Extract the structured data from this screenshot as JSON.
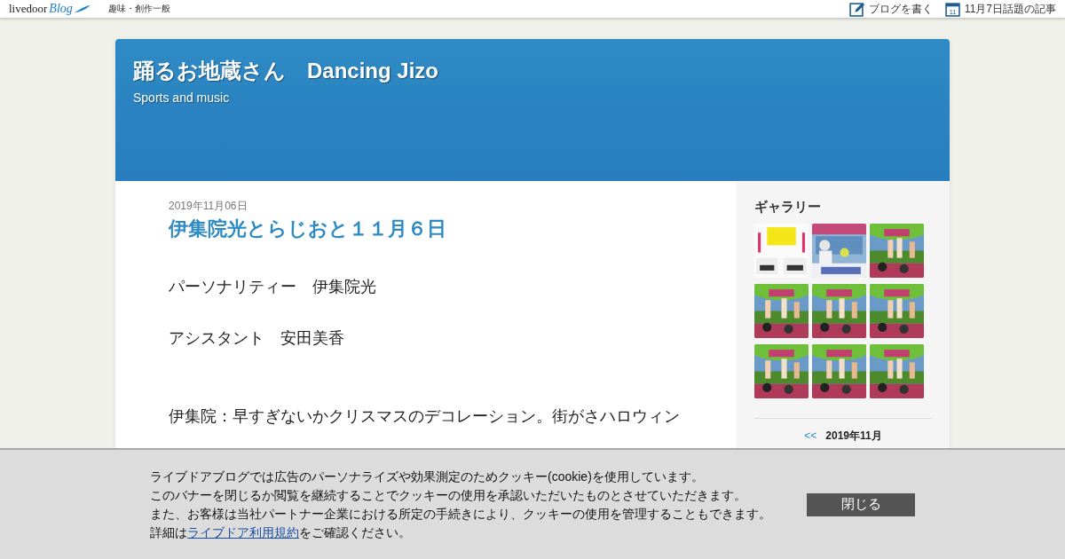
{
  "topbar": {
    "logo_main": "livedoor",
    "logo_sub": "Blog",
    "category": "趣味・創作一般",
    "links": [
      {
        "kind": "write",
        "label": "ブログを書く"
      },
      {
        "kind": "calendar",
        "label": "11月7日話題の記事",
        "icon_text": "11"
      }
    ]
  },
  "header": {
    "title": "踊るお地蔵さん　Dancing Jizo",
    "subtitle": "Sports and music"
  },
  "article": {
    "date": "2019年11月06日",
    "title": "伊集院光とらじおと１１月６日",
    "paragraphs": [
      "パーソナリティー　伊集院光",
      "アシスタント　安田美香",
      "伊集院：早すぎないかクリスマスのデコレーション。街がさハロウィン"
    ]
  },
  "sidebar": {
    "gallery_title": "ギャラリー",
    "calendar_prev": "<<",
    "calendar_month": "2019年11月"
  },
  "cookie_banner": {
    "lines": [
      "ライブドアブログでは広告のパーソナライズや効果測定のためクッキー(cookie)を使用しています。",
      "このバナーを閉じるか閲覧を継続することでクッキーの使用を承認いただいたものとさせていただきます。",
      "また、お客様は当社パートナー企業における所定の手続きにより、クッキーの使用を管理することもできます。"
    ],
    "last_before": "詳細は",
    "last_link": "ライブドア利用規約",
    "last_after": "をご確認ください。",
    "close": "閉じる"
  }
}
